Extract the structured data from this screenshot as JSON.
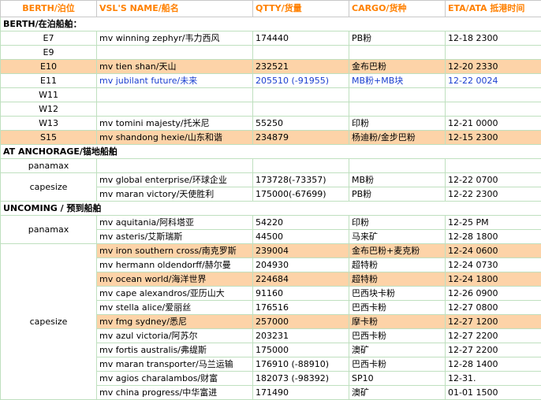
{
  "columns": [
    "BERTH/泊位",
    "VSL'S NAME/船名",
    "QTTY/货量",
    "CARGO/货种",
    "ETA/ATA 抵港时间"
  ],
  "sections": {
    "berth": "BERTH/在泊船舶：",
    "anchorage": "AT ANCHORAGE/锚地船舶",
    "incoming": "UNCOMING / 预到船舶"
  },
  "berth_rows": [
    {
      "berth": "E7",
      "name": "mv winning zephyr/韦力西风",
      "qty": "174440",
      "cargo": "PB粉",
      "eta": "12-18 2300"
    },
    {
      "berth": "E9",
      "name": "",
      "qty": "",
      "cargo": "",
      "eta": ""
    },
    {
      "berth": "E10",
      "name": "mv tien shan/天山",
      "qty": "232521",
      "cargo": "金布巴粉",
      "eta": "12-20 2330"
    },
    {
      "berth": "E11",
      "name": "mv jubilant future/未来",
      "qty": "205510 (-91955)",
      "cargo": "MB粉+MB块",
      "eta": "12-22 0024"
    },
    {
      "berth": "W11",
      "name": "",
      "qty": "",
      "cargo": "",
      "eta": ""
    },
    {
      "berth": "W12",
      "name": "",
      "qty": "",
      "cargo": "",
      "eta": ""
    },
    {
      "berth": "W13",
      "name": "mv tomini majesty/托米尼",
      "qty": "55250",
      "cargo": "印粉",
      "eta": "12-21 0000"
    },
    {
      "berth": "S15",
      "name": "mv shandong hexie/山东和谐",
      "qty": "234879",
      "cargo": "杨迪粉/金步巴粉",
      "eta": "12-15 2300"
    }
  ],
  "anchorage_groups": {
    "panamax": "panamax",
    "capesize": "capesize"
  },
  "anchorage_rows": [
    {
      "name": "",
      "qty": "",
      "cargo": "",
      "eta": ""
    },
    {
      "name": "mv global enterprise/环球企业",
      "qty": "173728(-73357)",
      "cargo": "MB粉",
      "eta": "12-22 0700"
    },
    {
      "name": "mv maran victory/天使胜利",
      "qty": "175000(-67699)",
      "cargo": "PB粉",
      "eta": "12-22 2300"
    }
  ],
  "incoming_groups": {
    "panamax": "panamax",
    "capesize": "capesize"
  },
  "incoming_rows": [
    {
      "name": "mv aquitania/阿科塔亚",
      "qty": "54220",
      "cargo": "印粉",
      "eta": "12-25 PM"
    },
    {
      "name": "mv asteris/艾斯瑞斯",
      "qty": "44500",
      "cargo": "马来矿",
      "eta": "12-28 1800"
    },
    {
      "name": "mv iron southern cross/南克罗斯",
      "qty": "239004",
      "cargo": "金布巴粉+麦克粉",
      "eta": "12-24 0600"
    },
    {
      "name": "mv hermann oldendorff/赫尔曼",
      "qty": "204930",
      "cargo": "超特粉",
      "eta": "12-24 0730"
    },
    {
      "name": "mv ocean world/海洋世界",
      "qty": "224684",
      "cargo": "超特粉",
      "eta": "12-24 1800"
    },
    {
      "name": "mv cape alexandros/亚历山大",
      "qty": "91160",
      "cargo": "巴西块卡粉",
      "eta": "12-26 0900"
    },
    {
      "name": "mv stella alice/爱丽丝",
      "qty": "176516",
      "cargo": "巴西卡粉",
      "eta": "12-27 0800"
    },
    {
      "name": "mv fmg sydney/悉尼",
      "qty": "257000",
      "cargo": "摩卡粉",
      "eta": "12-27 1200"
    },
    {
      "name": "mv azul victoria/阿苏尔",
      "qty": "203231",
      "cargo": "巴西卡粉",
      "eta": "12-27 2200"
    },
    {
      "name": "mv fortis australis/弗缇斯",
      "qty": "175000",
      "cargo": "澳矿",
      "eta": "12-27 2200"
    },
    {
      "name": "mv maran transporter/马兰运输",
      "qty": "176910 (-88910)",
      "cargo": "巴西卡粉",
      "eta": "12-28 1400"
    },
    {
      "name": "mv agios charalambos/财富",
      "qty": "182073 (-98392)",
      "cargo": "SP10",
      "eta": "12-31."
    },
    {
      "name": "mv china progress/中华富进",
      "qty": "171490",
      "cargo": "澳矿",
      "eta": "01-01 1500"
    }
  ],
  "colors": {
    "header_text": "#ff8000",
    "highlight": "#fdd3a8",
    "blue_text": "#1a3fd0",
    "grid": "#bfe0bf"
  }
}
